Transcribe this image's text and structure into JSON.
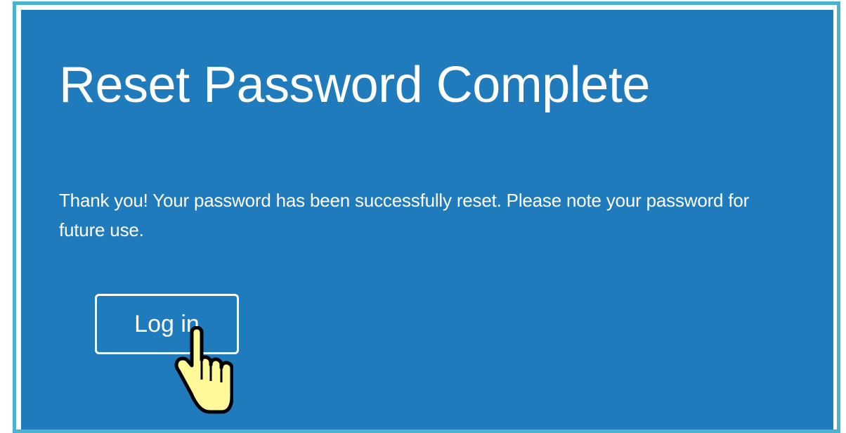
{
  "page": {
    "title": "Reset Password Complete",
    "message": "Thank you! Your password has been successfully reset. Please note your password for future use."
  },
  "actions": {
    "login_label": "Log in"
  },
  "cursor": {
    "icon": "hand-pointer-icon"
  },
  "colors": {
    "panel_background": "#1f7bbc",
    "frame_border": "#4ab3d0",
    "text": "#ffffff",
    "cursor_fill": "#fff99a"
  }
}
